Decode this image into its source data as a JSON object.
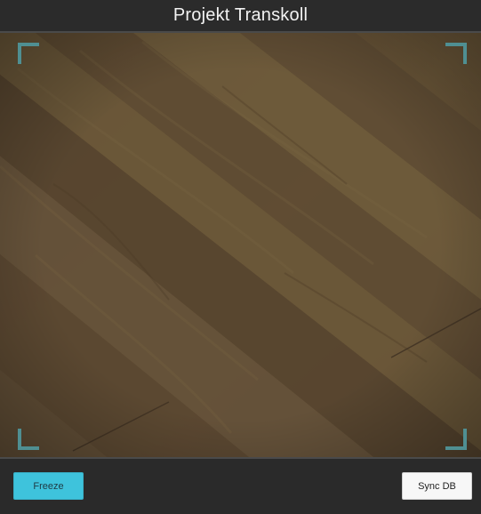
{
  "app": {
    "title": "Projekt Transkoll"
  },
  "camera": {
    "frame_color": "#4f8f92",
    "scene": "wooden-floor-camera-feed"
  },
  "toolbar": {
    "freeze_label": "Freeze",
    "sync_label": "Sync DB",
    "freeze_color": "#3ec3dc"
  }
}
